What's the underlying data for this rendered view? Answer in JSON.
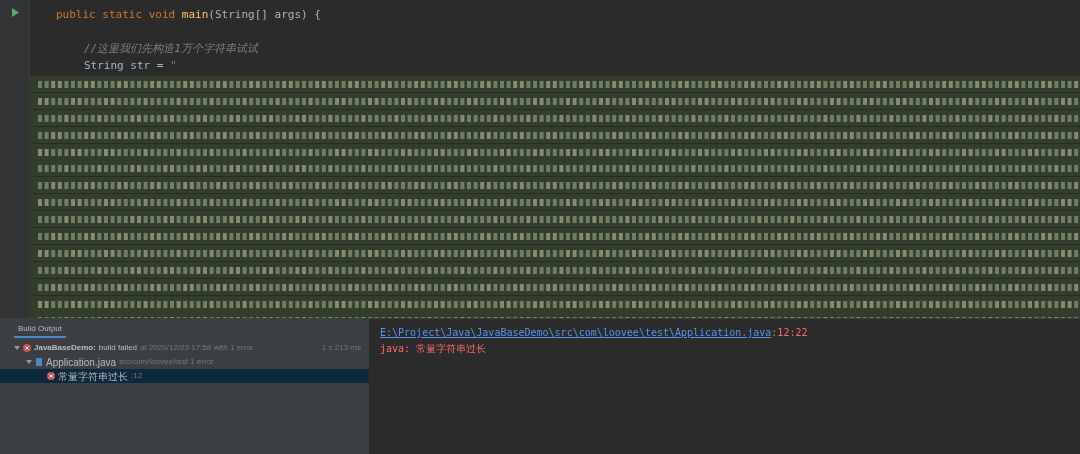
{
  "editor": {
    "lines": [
      {
        "kind": "signature",
        "parts": [
          {
            "t": "public static void ",
            "kind": "keyword"
          },
          {
            "t": "main",
            "kind": "method"
          },
          {
            "t": "(String[] args) {",
            "kind": "plain"
          }
        ]
      },
      {
        "kind": "blank"
      },
      {
        "kind": "comment",
        "parts": [
          {
            "t": "//这里我们先构造1万个字符串试试",
            "kind": "comment"
          }
        ]
      },
      {
        "kind": "code",
        "parts": [
          {
            "t": "String str = ",
            "kind": "plain"
          },
          {
            "t": "\"",
            "kind": "string"
          }
        ]
      }
    ]
  },
  "build": {
    "tab": {
      "label": "Build Output",
      "selected": true
    },
    "tree": [
      {
        "kind": "error",
        "title": "JavaBaseDemo:",
        "detail": "build failed",
        "meta": "at 2020/12/23 17:58 with 1 error",
        "time": "1 s 213 ms",
        "expanded": true,
        "selected": false,
        "children": [
          {
            "kind": "file",
            "title": "Application.java",
            "meta": "src/com/loovee/test 1 error",
            "expanded": true,
            "selected": false,
            "children": [
              {
                "kind": "error",
                "title": "常量字符串过长",
                "meta": ":12",
                "selected": true
              }
            ]
          }
        ]
      }
    ]
  },
  "console": {
    "link": "E:\\Project\\Java\\JavaBaseDemo\\src\\com\\loovee\\test\\Application.java",
    "position": ":12:22",
    "message": "java: 常量字符串过长"
  }
}
